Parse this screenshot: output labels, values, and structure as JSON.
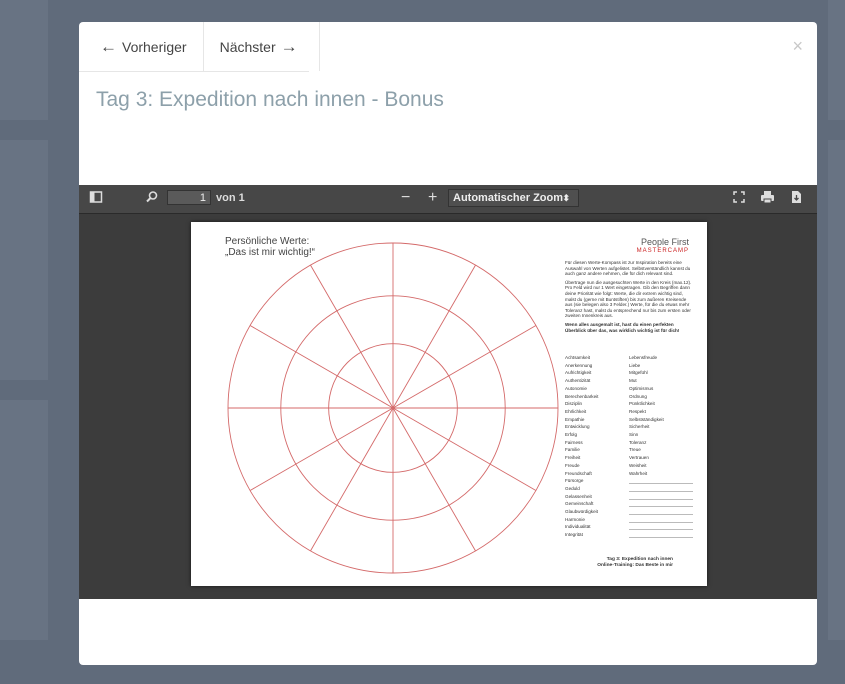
{
  "modal": {
    "prev_label": "Vorheriger",
    "next_label": "Nächster",
    "close_label": "×",
    "title": "Tag 3: Expedition nach innen - Bonus"
  },
  "viewer": {
    "page_number": "1",
    "page_count_label": "von 1",
    "zoom_label": "Automatischer Zoom",
    "zoom_minus": "−",
    "zoom_plus": "+"
  },
  "document": {
    "title_line1": "Persönliche Werte:",
    "title_line2": "„Das ist mir wichtig!“",
    "logo_line1": "People First",
    "logo_line2": "MASTERCAMP",
    "intro_p1": "Für diesen Werte-Kompass ist zur Inspiration bereits eine Auswahl von Werten aufgelistet. Selbstverständlich kannst du auch ganz andere nehmen, die für dich relevant sind.",
    "intro_p2": "Übertrage nun die ausgesuchten Werte in den Kreis (max.12). Pro Feld wird nur 1 Wert eingetragen. Gib den Begriffen dann deine Priorität wie folgt: Werte, die dir extrem wichtig sind, malst du (gerne mit Buntstiften) bis zum äußeren Kreisende aus (sie belegen also 3 Felder.) Werte, für die du etwas mehr Toleranz hast, malst du entsprechend nur bis zum ersten oder zweiten Innenkreis aus.",
    "intro_p3": "Wenn alles ausgemalt ist, hast du einen perfekten Überblick über das, was wirklich wichtig ist für dich!",
    "values_col1": [
      "Achtsamkeit",
      "Anerkennung",
      "Aufrichtigkeit",
      "Authentizität",
      "Autonomie",
      "Berechenbarkeit",
      "Disziplin",
      "Ehrlichkeit",
      "Empathie",
      "Entwicklung",
      "Erfolg",
      "Fairness",
      "Familie",
      "Freiheit",
      "Freude",
      "Freundschaft",
      "Fürsorge",
      "Geduld",
      "Gelassenheit",
      "Gemeinschaft",
      "Glaubwürdigkeit",
      "Harmonie",
      "Individualität",
      "Integrität"
    ],
    "values_col2": [
      "Lebensfreude",
      "Liebe",
      "Mitgefühl",
      "Mut",
      "Optimismus",
      "Ordnung",
      "Pünktlichkeit",
      "Respekt",
      "Selbstständigkeit",
      "Sicherheit",
      "Sinn",
      "Toleranz",
      "Treue",
      "Vertrauen",
      "Weisheit",
      "Wahrheit",
      "",
      "",
      "",
      "",
      "",
      "",
      "",
      ""
    ],
    "footer_line1": "Tag 3: Expedition nach innen",
    "footer_line2": "Online-Training: Das Beste in mir"
  },
  "colors": {
    "wheel_stroke": "#d46a6a",
    "title_color": "#8da0aa",
    "viewer_bg": "#3c3c3c"
  },
  "icons": [
    "arrow-left-icon",
    "arrow-right-icon",
    "close-icon",
    "sidebar-toggle-icon",
    "search-icon",
    "presentation-mode-icon",
    "print-icon",
    "download-icon",
    "chevron-updown-icon"
  ]
}
